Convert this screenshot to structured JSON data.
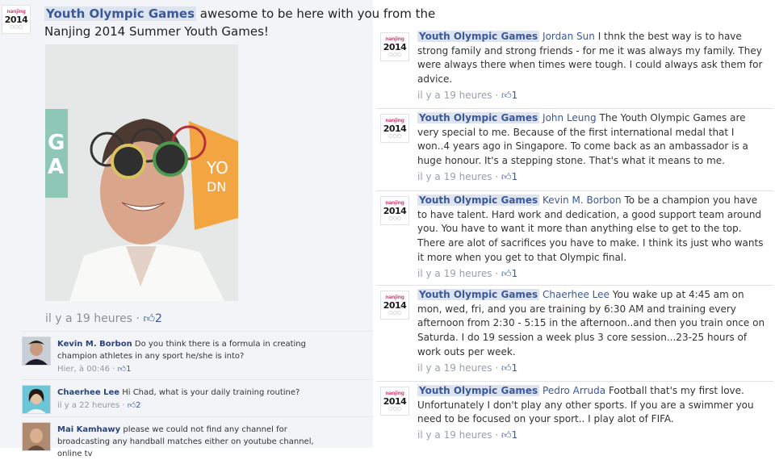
{
  "page_name": "Youth Olympic Games",
  "avatar": {
    "top": "nanjing",
    "year": "2014",
    "rings": "○○○"
  },
  "post": {
    "text_line1": "awesome to be here with you from the",
    "text_line2": "Nanjing 2014 Summer Youth Games!",
    "time": "il y a 19 heures",
    "sep": "·",
    "like_icon": "thumbs-up-icon",
    "likes": "2"
  },
  "comments": [
    {
      "name": "Kevin M. Borbon",
      "text": "Do you think there is a formula in creating champion athletes in any sport he/she is into?",
      "time": "Hier, à 00:46",
      "sep": "·",
      "likes": "1"
    },
    {
      "name": "Chaerhee Lee",
      "text": "Hi Chad, what is your daily training routine?",
      "time": "il y a 22 heures",
      "sep": "·",
      "likes": "2"
    },
    {
      "name": "Mai Kamhawy",
      "text": "please we could not find any channel for broadcasting any handball matches either on youtube channel, online tv",
      "time": "",
      "sep": "",
      "likes": ""
    }
  ],
  "replies": [
    {
      "mention": "Jordan Sun",
      "text": "I thnk the best way is to have strong family and strong friends - for me it was always my family. They were always there when times were tough. I could always ask them for advice.",
      "time": "il y a 19 heures",
      "sep": "·",
      "likes": "1"
    },
    {
      "mention": "John Leung",
      "text": "The Youth Olympic Games are very special to me. Because of the first international medal that I won..4 years ago in Singapore. To come back as an ambassador is a huge honour. It's a stepping stone. That's what it means to me.",
      "time": "il y a 19 heures",
      "sep": "·",
      "likes": "1"
    },
    {
      "mention": "Kevin M. Borbon",
      "text": "To be a champion you have to have talent. Hard work and dedication, a good support team around you. You have to want it more than anything else to get to the top. There are alot of sacrifices you have to make. I think its just who wants it more when you get to that Olympic final.",
      "time": "il y a 19 heures",
      "sep": "·",
      "likes": "1"
    },
    {
      "mention": "Chaerhee Lee",
      "text": "You wake up at 4:45 am on mon, wed, fri, and you are training by 6:30 AM and training every afternoon from 2:30 - 5:15 in the afternoon..and then you train once on Saturda. I do 19 session a week plus 3 core session...23-25 hours of work outs per week.",
      "time": "il y a 19 heures",
      "sep": "·",
      "likes": "1"
    },
    {
      "mention": "Pedro Arruda",
      "text": "Football that's my first love. Unfortunately I don't play any other sports. If you are a swimmer you need to be focused on your sport.. I play alot of FIFA.",
      "time": "il y a 19 heures",
      "sep": "·",
      "likes": "1"
    }
  ],
  "colors": {
    "link": "#3b5998",
    "highlight": "#dde3ef",
    "meta": "#9197a3",
    "left_bg": "#f3f4f7"
  }
}
